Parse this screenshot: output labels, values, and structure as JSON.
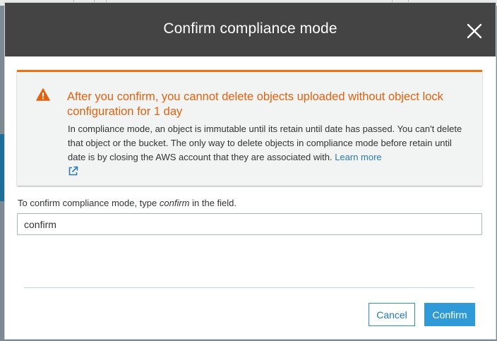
{
  "modal": {
    "title": "Confirm compliance mode",
    "close_icon": "close-icon"
  },
  "alert": {
    "icon": "warning-icon",
    "heading": "After you confirm, you cannot delete objects uploaded without object lock configuration for 1 day",
    "body": "In compliance mode, an object is immutable until its retain until date has passed. You can't delete that object or the bucket. The only way to delete objects in compliance mode before retain until date is by closing the AWS account that they are associated with.",
    "learn_more": "Learn more",
    "external_link_icon": "external-link-icon"
  },
  "field": {
    "label_prefix": "To confirm compliance mode, type",
    "label_keyword": "confirm",
    "label_suffix": "in the field.",
    "value": "confirm"
  },
  "buttons": {
    "cancel": "Cancel",
    "confirm": "Confirm"
  },
  "colors": {
    "header_bg": "#444444",
    "alert_accent": "#ec7211",
    "alert_heading": "#e2620f",
    "link": "#2a7ab6",
    "primary_button": "#2e9bd8"
  }
}
